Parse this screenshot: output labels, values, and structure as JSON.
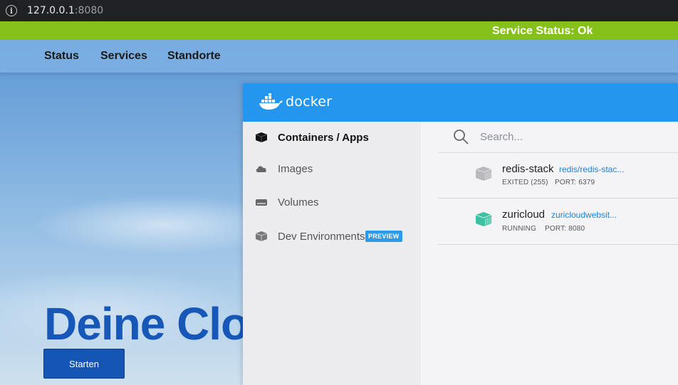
{
  "browser": {
    "host": "127.0.0.1",
    "port": ":8080"
  },
  "status_bar": {
    "text": "Service Status: Ok"
  },
  "nav": {
    "items": [
      {
        "label": "Status"
      },
      {
        "label": "Services"
      },
      {
        "label": "Standorte"
      }
    ]
  },
  "hero": {
    "title": "Deine Clou",
    "button_label": "Starten"
  },
  "docker": {
    "logo_text": "docker",
    "sidebar": {
      "items": [
        {
          "label": "Containers / Apps",
          "icon": "container-icon",
          "active": true
        },
        {
          "label": "Images",
          "icon": "cloud-icon"
        },
        {
          "label": "Volumes",
          "icon": "volume-icon"
        },
        {
          "label": "Dev Environments",
          "icon": "dev-environments-icon",
          "badge": "PREVIEW"
        }
      ]
    },
    "search": {
      "placeholder": "Search..."
    },
    "containers": [
      {
        "name": "redis-stack",
        "image": "redis/redis-stac...",
        "status": "EXITED (255)",
        "port": "PORT: 6379",
        "state_color": "#b9b9bd"
      },
      {
        "name": "zuricloud",
        "image": "zuricloudwebsit...",
        "status": "RUNNING",
        "port": "PORT: 8080",
        "state_color": "#3ec1a3"
      }
    ],
    "colors": {
      "header": "#2496ed",
      "accent": "#2b9ae8"
    }
  }
}
